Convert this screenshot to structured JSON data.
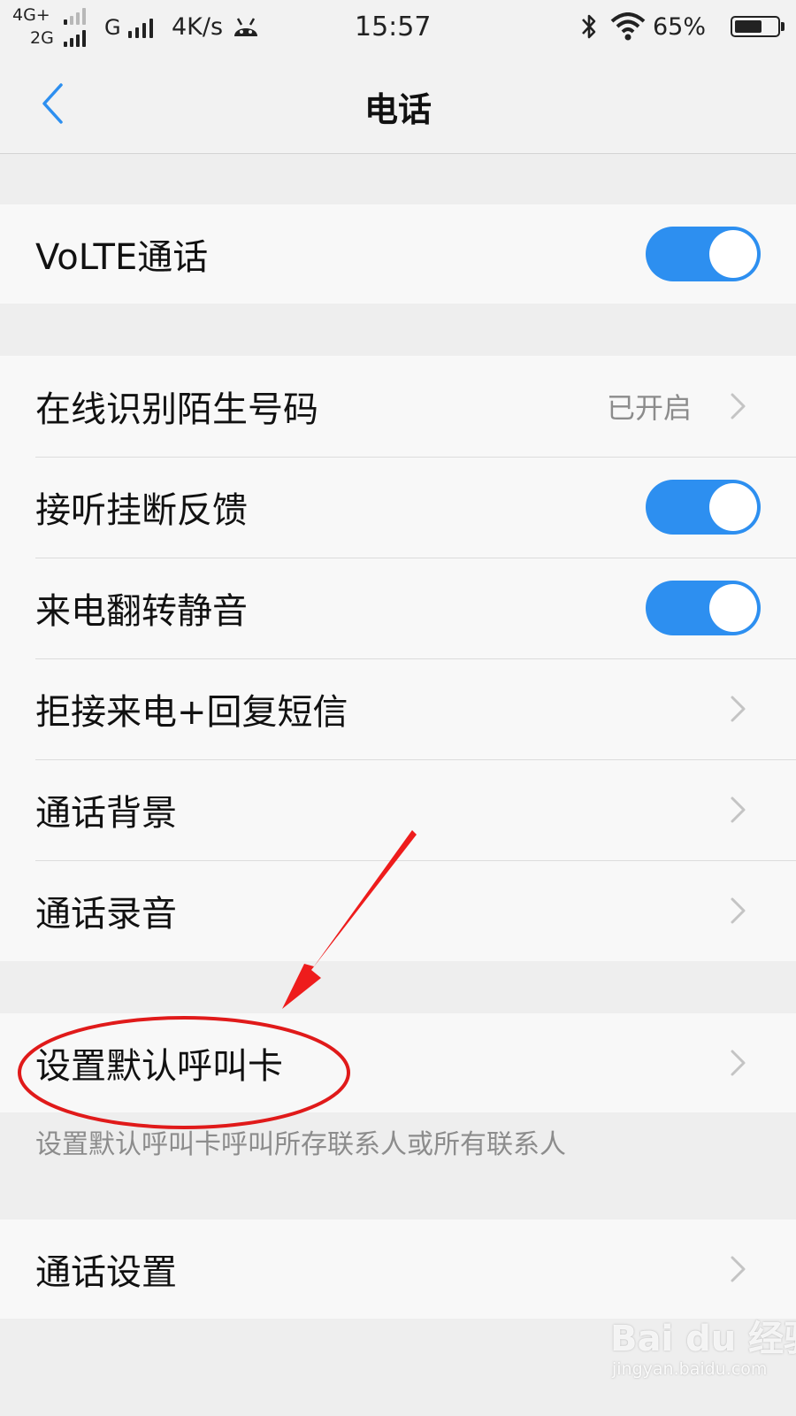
{
  "status_bar": {
    "network_primary": "4G+",
    "network_secondary": "2G",
    "carrier_type": "G",
    "speed": "4K/s",
    "time": "15:57",
    "battery": "65%",
    "battery_level": 0.65,
    "icons": [
      "android-icon",
      "bluetooth-icon",
      "wifi-icon",
      "battery-icon"
    ]
  },
  "header": {
    "title": "电话",
    "back_icon": "chevron-left-icon"
  },
  "accent_color": "#2d8ff0",
  "sections": {
    "volte": {
      "label": "VoLTE通话",
      "enabled": true
    },
    "call_features": [
      {
        "label": "在线识别陌生号码",
        "value": "已开启",
        "control": "chevron"
      },
      {
        "label": "接听挂断反馈",
        "control": "toggle",
        "enabled": true
      },
      {
        "label": "来电翻转静音",
        "control": "toggle",
        "enabled": true
      },
      {
        "label": "拒接来电+回复短信",
        "control": "chevron"
      },
      {
        "label": "通话背景",
        "control": "chevron"
      },
      {
        "label": "通话录音",
        "control": "chevron"
      }
    ],
    "default_card": {
      "label": "设置默认呼叫卡",
      "description": "设置默认呼叫卡呼叫所存联系人或所有联系人"
    },
    "call_settings": {
      "label": "通话设置"
    }
  },
  "annotation": {
    "arrow_color": "#ee1c1c",
    "circle_color": "#e01a1a"
  },
  "watermark": {
    "logo": "Bai du 经验",
    "url": "jingyan.baidu.com"
  }
}
